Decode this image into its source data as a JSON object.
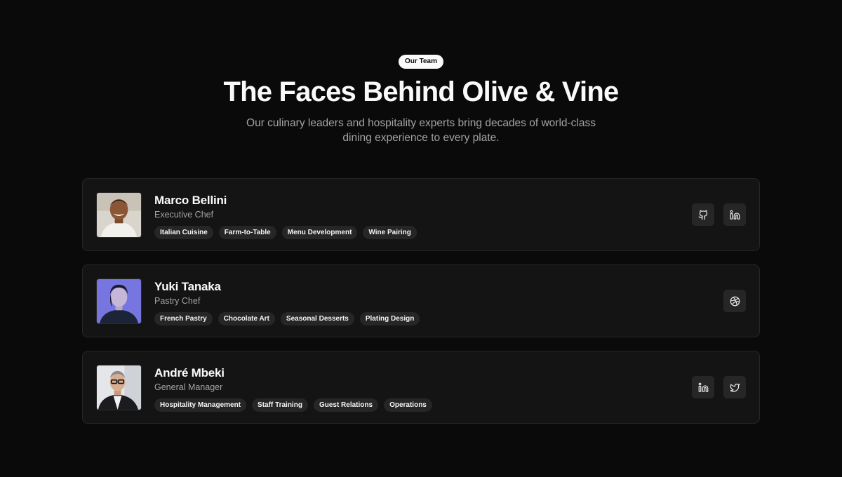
{
  "header": {
    "badge": "Our Team",
    "title": "The Faces Behind Olive & Vine",
    "subtitle": "Our culinary leaders and hospitality experts bring decades of world-class dining experience to every plate."
  },
  "team": [
    {
      "name": "Marco Bellini",
      "role": "Executive Chef",
      "tags": [
        "Italian Cuisine",
        "Farm-to-Table",
        "Menu Development",
        "Wine Pairing"
      ],
      "socials": [
        "github-icon",
        "linkedin-icon"
      ]
    },
    {
      "name": "Yuki Tanaka",
      "role": "Pastry Chef",
      "tags": [
        "French Pastry",
        "Chocolate Art",
        "Seasonal Desserts",
        "Plating Design"
      ],
      "socials": [
        "dribbble-icon"
      ]
    },
    {
      "name": "André Mbeki",
      "role": "General Manager",
      "tags": [
        "Hospitality Management",
        "Staff Training",
        "Guest Relations",
        "Operations"
      ],
      "socials": [
        "linkedin-icon",
        "twitter-icon"
      ]
    }
  ],
  "colors": {
    "background": "#0a0a0a",
    "card": "#141414",
    "card_border": "#262626",
    "tag_bg": "#262626",
    "text_primary": "#fafafa",
    "text_muted": "#a3a3a3"
  }
}
